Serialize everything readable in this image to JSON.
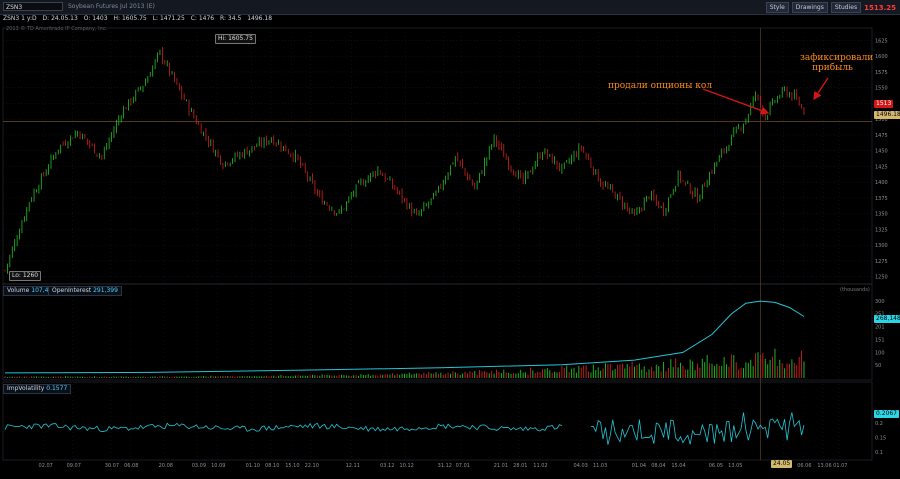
{
  "toolbar": {
    "symbol": "ZSN3",
    "name": "Soybean Futures Jul 2013 (E)",
    "buttons": [
      "Style",
      "Drawings",
      "Studies"
    ],
    "last_price": "1513.25"
  },
  "quote": {
    "tf": "ZSN3 1 y:D",
    "date": "D: 24.05.13",
    "open": "O: 1403",
    "high": "H: 1605.75",
    "low": "L: 1471.25",
    "close": "C: 1476",
    "ch": "R: 34.5",
    "last": "1496.18"
  },
  "copyright": "2013 © TD Ameritrade IP Company, Inc.",
  "annotations": {
    "sold": "продали опционы кол",
    "fixed_1": "зафиксировали",
    "fixed_2": "прибыль"
  },
  "price_tags": {
    "hi": "Hi: 1605.75",
    "lo": "Lo: 1260",
    "red": "1513",
    "cur": "1496.18",
    "date": "24.05"
  },
  "volume_panel": {
    "label": "Volume",
    "vol": "107,436",
    "oi_label": "OpenInterest",
    "oi": "291,399",
    "oi_tag": "268,148",
    "unit": "(thousands)"
  },
  "iv_panel": {
    "label": "ImpVolatility",
    "value": "0.1577",
    "tag": "0.2067"
  },
  "chart_data": [
    {
      "type": "candlestick",
      "ylim": [
        1240,
        1640
      ],
      "y_ticks": [
        1250,
        1275,
        1300,
        1325,
        1350,
        1375,
        1400,
        1425,
        1450,
        1475,
        1500,
        1525,
        1550,
        1575,
        1600,
        1625
      ],
      "x_ticks": [
        "02.07",
        "09.07",
        "30.07",
        "06.08",
        "20.08",
        "03.09",
        "10.09",
        "01.10",
        "08.10",
        "15.10",
        "22.10",
        "12.11",
        "03.12",
        "10.12",
        "31.12",
        "07.01",
        "21.01",
        "28.01",
        "11.02",
        "04.03",
        "11.03",
        "01.04",
        "08.04",
        "15.04",
        "06.05",
        "13.05",
        "24.05",
        "06.06",
        "13.06",
        "01.07"
      ],
      "x_tick_pos": [
        0.055,
        0.094,
        0.147,
        0.174,
        0.222,
        0.268,
        0.295,
        0.343,
        0.37,
        0.398,
        0.425,
        0.482,
        0.53,
        0.557,
        0.61,
        0.635,
        0.688,
        0.715,
        0.743,
        0.799,
        0.826,
        0.88,
        0.907,
        0.935,
        0.987,
        1.014,
        1.083,
        1.11,
        1.138,
        1.16
      ],
      "key_points": [
        {
          "i": 0,
          "p": 1260
        },
        {
          "i": 10,
          "p": 1370
        },
        {
          "i": 22,
          "p": 1455
        },
        {
          "i": 30,
          "p": 1480
        },
        {
          "i": 40,
          "p": 1440
        },
        {
          "i": 48,
          "p": 1510
        },
        {
          "i": 58,
          "p": 1560
        },
        {
          "i": 64,
          "p": 1605.75
        },
        {
          "i": 72,
          "p": 1545
        },
        {
          "i": 80,
          "p": 1490
        },
        {
          "i": 90,
          "p": 1430
        },
        {
          "i": 100,
          "p": 1450
        },
        {
          "i": 110,
          "p": 1470
        },
        {
          "i": 120,
          "p": 1440
        },
        {
          "i": 130,
          "p": 1375
        },
        {
          "i": 138,
          "p": 1350
        },
        {
          "i": 146,
          "p": 1395
        },
        {
          "i": 154,
          "p": 1420
        },
        {
          "i": 162,
          "p": 1385
        },
        {
          "i": 170,
          "p": 1345
        },
        {
          "i": 178,
          "p": 1380
        },
        {
          "i": 186,
          "p": 1440
        },
        {
          "i": 194,
          "p": 1390
        },
        {
          "i": 202,
          "p": 1470
        },
        {
          "i": 208,
          "p": 1430
        },
        {
          "i": 214,
          "p": 1400
        },
        {
          "i": 222,
          "p": 1450
        },
        {
          "i": 230,
          "p": 1420
        },
        {
          "i": 238,
          "p": 1455
        },
        {
          "i": 246,
          "p": 1400
        },
        {
          "i": 252,
          "p": 1380
        },
        {
          "i": 260,
          "p": 1345
        },
        {
          "i": 266,
          "p": 1380
        },
        {
          "i": 272,
          "p": 1355
        },
        {
          "i": 278,
          "p": 1410
        },
        {
          "i": 286,
          "p": 1375
        },
        {
          "i": 292,
          "p": 1420
        },
        {
          "i": 300,
          "p": 1470
        },
        {
          "i": 306,
          "p": 1500
        },
        {
          "i": 310,
          "p": 1540
        },
        {
          "i": 314,
          "p": 1505
        },
        {
          "i": 318,
          "p": 1530
        },
        {
          "i": 322,
          "p": 1545
        },
        {
          "i": 326,
          "p": 1535
        },
        {
          "i": 330,
          "p": 1513
        }
      ],
      "bars": 331,
      "hline": 1496.18,
      "cursor_index": 312
    },
    {
      "type": "bar+line",
      "series": [
        "Volume",
        "OpenInterest"
      ],
      "ylim": [
        0,
        320
      ],
      "y_ticks": [
        50,
        100,
        151,
        201,
        251,
        300
      ],
      "oi_points": [
        [
          0,
          20
        ],
        [
          60,
          22
        ],
        [
          120,
          30
        ],
        [
          180,
          40
        ],
        [
          230,
          52
        ],
        [
          260,
          70
        ],
        [
          280,
          100
        ],
        [
          292,
          170
        ],
        [
          300,
          250
        ],
        [
          306,
          292
        ],
        [
          312,
          300
        ],
        [
          318,
          295
        ],
        [
          324,
          275
        ],
        [
          330,
          240
        ]
      ]
    },
    {
      "type": "line",
      "series": [
        "ImpVolatility"
      ],
      "ylim": [
        0.08,
        0.3
      ],
      "y_ticks": [
        0.1,
        0.15,
        0.2
      ]
    }
  ]
}
